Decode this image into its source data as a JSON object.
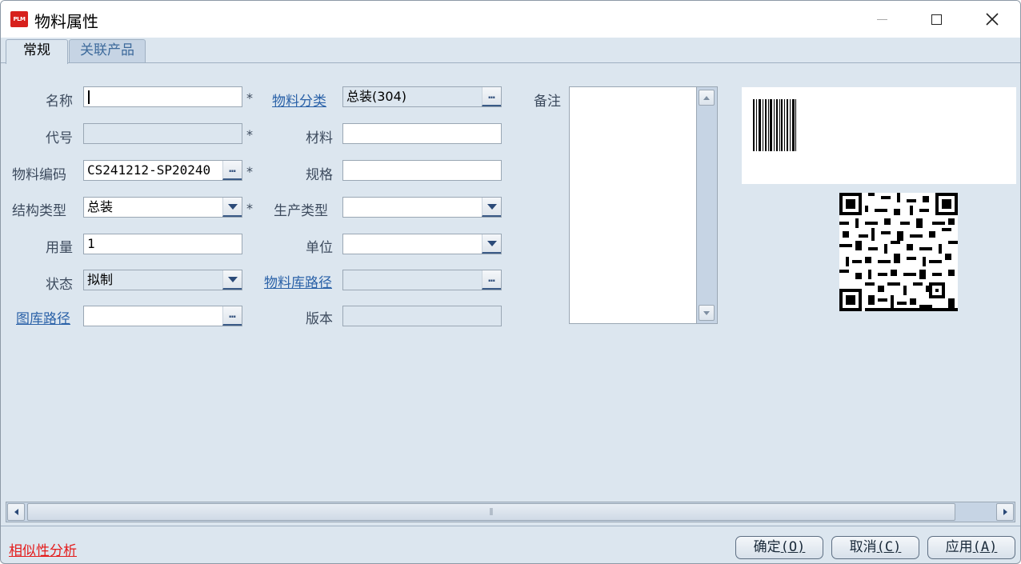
{
  "window": {
    "title": "物料属性",
    "app_badge": "PLM"
  },
  "tabs": [
    {
      "label": "常规",
      "active": true
    },
    {
      "label": "关联产品",
      "active": false
    }
  ],
  "form": {
    "name": {
      "label": "名称",
      "value": "",
      "required": "*"
    },
    "code": {
      "label": "代号",
      "value": "",
      "required": "*"
    },
    "material_code": {
      "label": "物料编码",
      "value": "CS241212-SP20240",
      "required": "*"
    },
    "structure_type": {
      "label": "结构类型",
      "value": "总装",
      "required": "*"
    },
    "quantity": {
      "label": "用量",
      "value": "1"
    },
    "status": {
      "label": "状态",
      "value": "拟制"
    },
    "drawing_path": {
      "label": "图库路径",
      "value": ""
    },
    "material_category": {
      "label": "物料分类",
      "value": "总装(304)"
    },
    "material": {
      "label": "材料",
      "value": ""
    },
    "spec": {
      "label": "规格",
      "value": ""
    },
    "production_type": {
      "label": "生产类型",
      "value": ""
    },
    "unit": {
      "label": "单位",
      "value": ""
    },
    "material_lib_path": {
      "label": "物料库路径",
      "value": ""
    },
    "version": {
      "label": "版本",
      "value": ""
    },
    "remarks": {
      "label": "备注",
      "value": ""
    }
  },
  "footer": {
    "similarity_link": "相似性分析",
    "ok": {
      "label": "确定",
      "mnemonic": "(O)"
    },
    "cancel": {
      "label": "取消",
      "mnemonic": "(C)"
    },
    "apply": {
      "label": "应用",
      "mnemonic": "(A)"
    }
  },
  "colors": {
    "window_bg": "#dce6ef",
    "link": "#2b62a8",
    "danger_link": "#e41c1c",
    "badge": "#d7201c"
  },
  "icons": {
    "ellipsis": "…",
    "dropdown": "chevron-down-icon",
    "close": "close-icon",
    "maximize": "maximize-icon",
    "minimize": "minimize-icon"
  }
}
